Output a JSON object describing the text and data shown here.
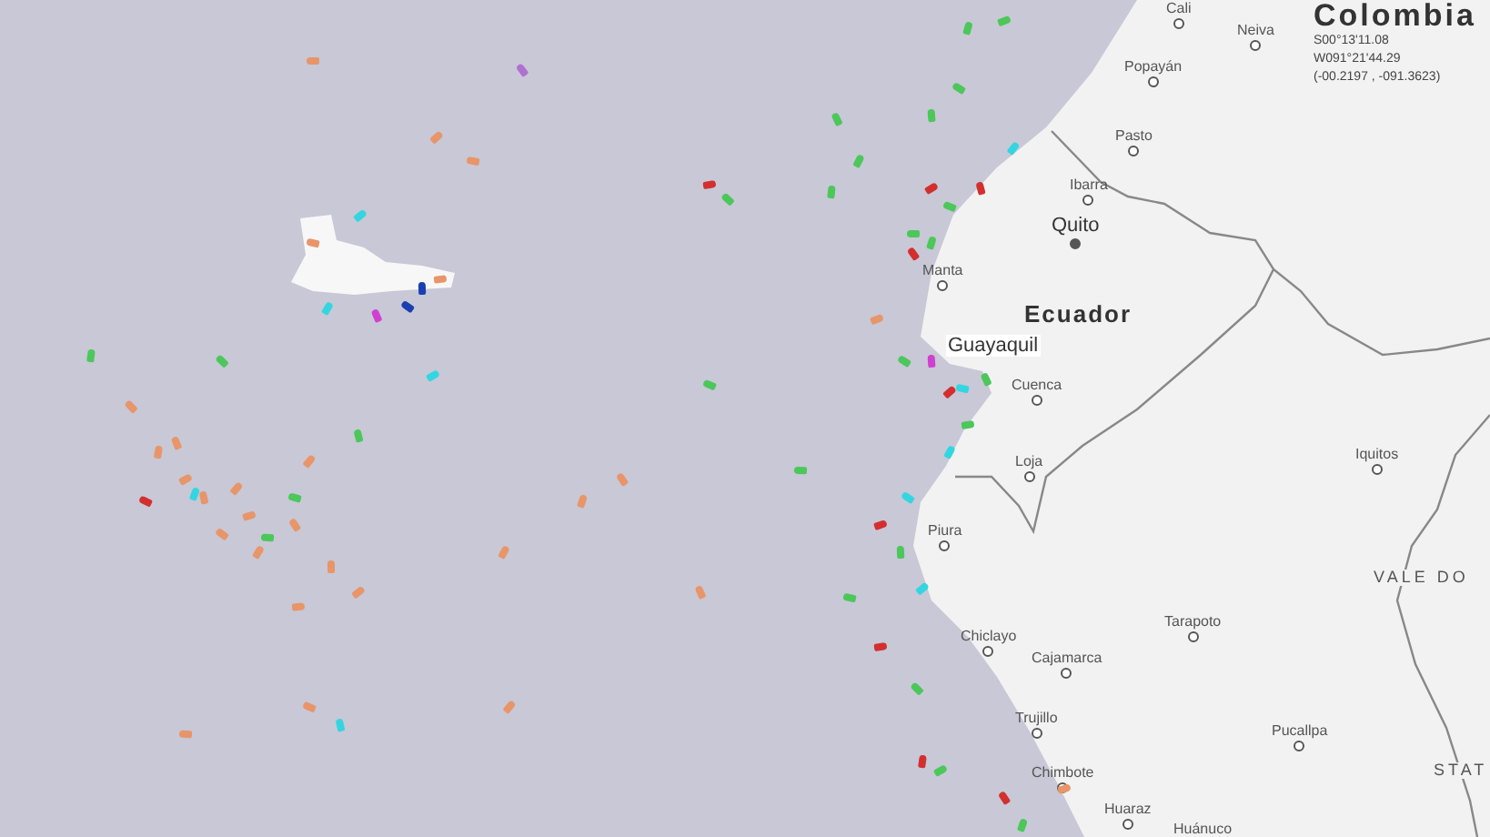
{
  "map": {
    "labels": [
      {
        "kind": "city",
        "text": "Cali"
      },
      {
        "kind": "city",
        "text": "Neiva"
      },
      {
        "kind": "city",
        "text": "Popayán"
      },
      {
        "kind": "city",
        "text": "Pasto"
      },
      {
        "kind": "city",
        "text": "Ibarra"
      },
      {
        "kind": "capital",
        "text": "Quito"
      },
      {
        "kind": "city",
        "text": "Manta"
      },
      {
        "kind": "country",
        "text": "Ecuador"
      },
      {
        "kind": "major",
        "text": "Guayaquil"
      },
      {
        "kind": "city",
        "text": "Cuenca"
      },
      {
        "kind": "city",
        "text": "Loja"
      },
      {
        "kind": "city",
        "text": "Iquitos"
      },
      {
        "kind": "city",
        "text": "Piura"
      },
      {
        "kind": "region",
        "text": "VALE DO"
      },
      {
        "kind": "city",
        "text": "Tarapoto"
      },
      {
        "kind": "city",
        "text": "Chiclayo"
      },
      {
        "kind": "city",
        "text": "Cajamarca"
      },
      {
        "kind": "city",
        "text": "Trujillo"
      },
      {
        "kind": "city",
        "text": "Pucallpa"
      },
      {
        "kind": "region",
        "text": "STAT"
      },
      {
        "kind": "city",
        "text": "Chimbote"
      },
      {
        "kind": "city",
        "text": "Huaraz"
      },
      {
        "kind": "city",
        "text": "Huánuco"
      }
    ],
    "readout": {
      "title": "Colombia",
      "lat": "S00°13'11.08",
      "lon": "W091°21'44.29",
      "decimal": "(-00.2197 , -091.3623)"
    },
    "ships": [
      {
        "color": "#e8956a"
      },
      {
        "color": "#b070d0"
      },
      {
        "color": "#4cc75a"
      },
      {
        "color": "#4cc75a"
      },
      {
        "color": "#4cc75a"
      },
      {
        "color": "#4cc75a"
      },
      {
        "color": "#e8956a"
      },
      {
        "color": "#e8956a"
      },
      {
        "color": "#4cc75a"
      },
      {
        "color": "#4cc75a"
      },
      {
        "color": "#d32f2f"
      },
      {
        "color": "#4cc75a"
      },
      {
        "color": "#4cc75a"
      },
      {
        "color": "#d32f2f"
      },
      {
        "color": "#4cc75a"
      },
      {
        "color": "#d32f2f"
      },
      {
        "color": "#33d6e0"
      },
      {
        "color": "#4cc75a"
      },
      {
        "color": "#d32f2f"
      },
      {
        "color": "#4cc75a"
      },
      {
        "color": "#e8956a"
      },
      {
        "color": "#4cc75a"
      },
      {
        "color": "#d040d0"
      },
      {
        "color": "#d32f2f"
      },
      {
        "color": "#33d6e0"
      },
      {
        "color": "#4cc75a"
      },
      {
        "color": "#33d6e0"
      },
      {
        "color": "#4cc75a"
      },
      {
        "color": "#4cc75a"
      },
      {
        "color": "#4cc75a"
      },
      {
        "color": "#33d6e0"
      },
      {
        "color": "#4cc75a"
      },
      {
        "color": "#4cc75a"
      },
      {
        "color": "#e8956a"
      },
      {
        "color": "#4cc75a"
      },
      {
        "color": "#e8956a"
      },
      {
        "color": "#e8956a"
      },
      {
        "color": "#d32f2f"
      },
      {
        "color": "#33d6e0"
      },
      {
        "color": "#4cc75a"
      },
      {
        "color": "#33d6e0"
      },
      {
        "color": "#4cc75a"
      },
      {
        "color": "#e8956a"
      },
      {
        "color": "#e8956a"
      },
      {
        "color": "#d32f2f"
      },
      {
        "color": "#4cc75a"
      },
      {
        "color": "#d32f2f"
      },
      {
        "color": "#4cc75a"
      },
      {
        "color": "#e8956a"
      },
      {
        "color": "#33d6e0"
      },
      {
        "color": "#e8956a"
      },
      {
        "color": "#e8956a"
      },
      {
        "color": "#d32f2f"
      },
      {
        "color": "#4cc75a"
      },
      {
        "color": "#e8956a"
      },
      {
        "color": "#1a3fb0"
      },
      {
        "color": "#1a3fb0"
      },
      {
        "color": "#33d6e0"
      },
      {
        "color": "#e8956a"
      },
      {
        "color": "#d040d0"
      },
      {
        "color": "#33d6e0"
      },
      {
        "color": "#e8956a"
      },
      {
        "color": "#e8956a"
      },
      {
        "color": "#e8956a"
      },
      {
        "color": "#e8956a"
      },
      {
        "color": "#d32f2f"
      },
      {
        "color": "#e8956a"
      },
      {
        "color": "#e8956a"
      },
      {
        "color": "#4cc75a"
      },
      {
        "color": "#e8956a"
      },
      {
        "color": "#33d6e0"
      },
      {
        "color": "#e8956a"
      },
      {
        "color": "#e8956a"
      },
      {
        "color": "#e8956a"
      },
      {
        "color": "#e8956a"
      },
      {
        "color": "#4cc75a"
      },
      {
        "color": "#e8956a"
      },
      {
        "color": "#e8956a"
      },
      {
        "color": "#e8956a"
      }
    ]
  }
}
